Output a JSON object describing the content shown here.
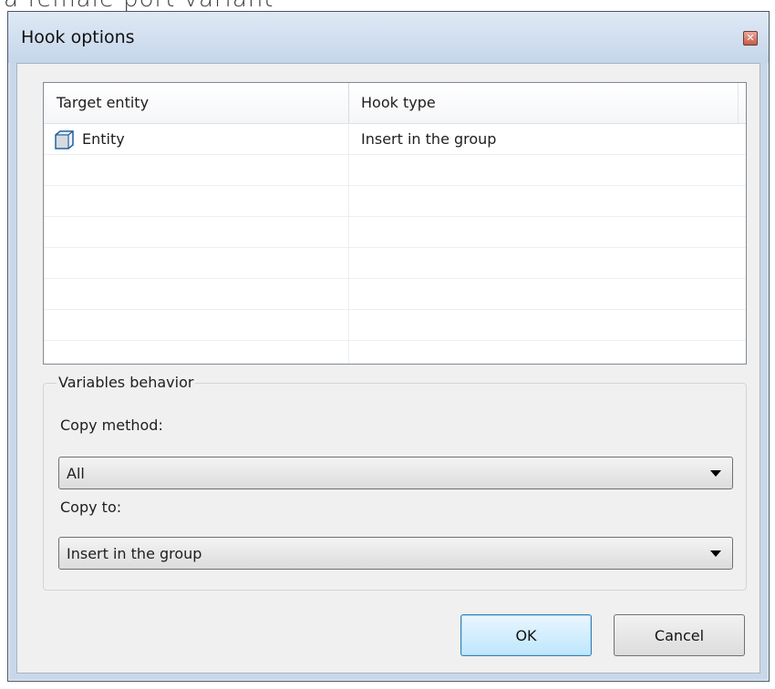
{
  "background_caption": "a female port variant",
  "dialog": {
    "title": "Hook options"
  },
  "list": {
    "columns": [
      "Target entity",
      "Hook type"
    ],
    "rows": [
      {
        "target": "Entity",
        "hook_type": "Insert in the group"
      }
    ]
  },
  "variables": {
    "group_label": "Variables behavior",
    "copy_method_label": "Copy method:",
    "copy_method_value": "All",
    "copy_to_label": "Copy to:",
    "copy_to_value": "Insert in the group"
  },
  "buttons": {
    "ok": "OK",
    "cancel": "Cancel"
  }
}
